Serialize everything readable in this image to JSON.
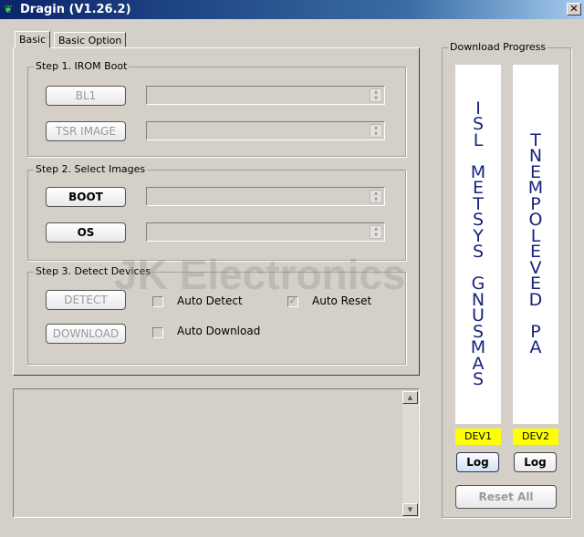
{
  "window": {
    "title": "Dragin (V1.26.2)",
    "close": "✕",
    "icon": "app-leaf-icon"
  },
  "tabs": [
    {
      "label": "Basic",
      "active": true
    },
    {
      "label": "Basic Option",
      "active": false
    }
  ],
  "step1": {
    "title": "Step 1. IROM Boot",
    "bl1": "BL1",
    "tsr": "TSR IMAGE"
  },
  "step2": {
    "title": "Step 2. Select Images",
    "boot": "BOOT",
    "os": "OS"
  },
  "step3": {
    "title": "Step 3. Detect Devices",
    "detect": "DETECT",
    "download": "DOWNLOAD",
    "auto_detect": {
      "label": "Auto Detect",
      "checked": false
    },
    "auto_reset": {
      "label": "Auto Reset",
      "checked": true
    },
    "auto_download": {
      "label": "Auto Download",
      "checked": false
    }
  },
  "progress": {
    "title": "Download Progress",
    "devices": [
      {
        "label": "DEV1",
        "text": "ISL METSYS GNUSMAS",
        "log": "Log"
      },
      {
        "label": "DEV2",
        "text": "TNEMPOLEVED PA",
        "log": "Log"
      }
    ],
    "dev_color": "#ffff00",
    "reset_all": "Reset All"
  },
  "watermark": "JK Electronics"
}
